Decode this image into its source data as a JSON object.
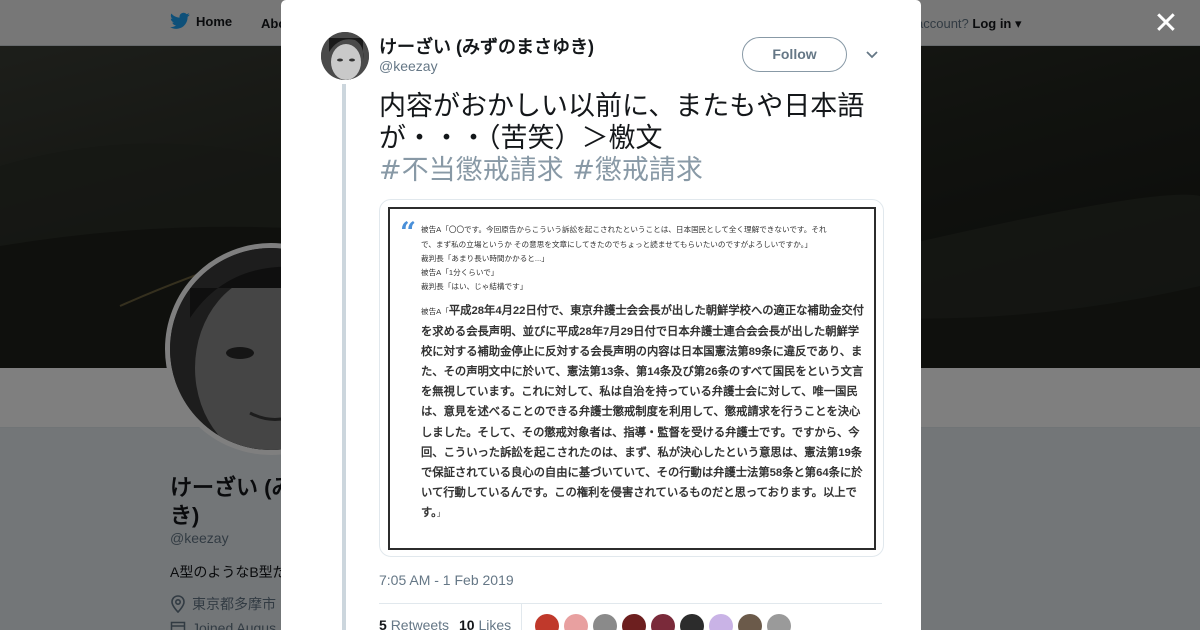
{
  "nav": {
    "home_label": "Home",
    "about_label": "Abo",
    "account_prompt": "account?",
    "login_label": "Log in"
  },
  "profile": {
    "name": "けーざい (み\nき)",
    "handle": "@keezay",
    "bio": "A型のようなB型だ",
    "location": "東京都多摩市",
    "joined": "Joined Augus"
  },
  "tweet": {
    "author_name": "けーざい (みずのまさゆき)",
    "author_handle": "@keezay",
    "follow_label": "Follow",
    "text": "内容がおかしい以前に、またもや日本語が・・・（苦笑）＞檄文",
    "hashtags": [
      "#不当懲戒請求",
      "#懲戒請求"
    ],
    "timestamp": "7:05 AM - 1 Feb 2019",
    "retweets_count": "5",
    "retweets_label": "Retweets",
    "likes_count": "10",
    "likes_label": "Likes",
    "liker_colors": [
      "#c0392b",
      "#e8a0a0",
      "#8a8a8a",
      "#6d1f1f",
      "#7a2a3a",
      "#2c2c2c",
      "#c9b3e6",
      "#6b5a4a",
      "#9a9a9a"
    ]
  },
  "document": {
    "small_lines": [
      "被告A「〇〇です。今回原告からこういう訴訟を起こされたということは、日本国民として全く理解できないです。それ",
      "で、まず私の立場というか その意思を文章にしてきたのでちょっと読ませてもらいたいのですがよろしいですか。」",
      "裁判長「あまり長い時間かかると...」",
      "被告A「1分くらいで」",
      "裁判長「はい、じゃ結構です」"
    ],
    "body_lead": "被告A「",
    "body_text": "平成28年4月22日付で、東京弁護士会会長が出した朝鮮学校への適正な補助金交付を求める会長声明、並びに平成28年7月29日付で日本弁護士連合会会長が出した朝鮮学校に対する補助金停止に反対する会長声明の内容は日本国憲法第89条に違反であり、また、その声明文中に於いて、憲法第13条、第14条及び第26条のすべて国民をという文言を無視しています。これに対して、私は自治を持っている弁護士会に対して、唯一国民は、意見を述べることのできる弁護士懲戒制度を利用して、懲戒請求を行うことを決心しました。そして、その懲戒対象者は、指導・監督を受ける弁護士です。ですから、今回、こういった訴訟を起こされたのは、まず、私が決心したという意思は、憲法第19条で保証されている良心の自由に基づいていて、その行動は弁護士法第58条と第64条に於いて行動しているんです。この権利を侵害されているものだと思っております。以上です。",
    "body_tail": "」"
  }
}
